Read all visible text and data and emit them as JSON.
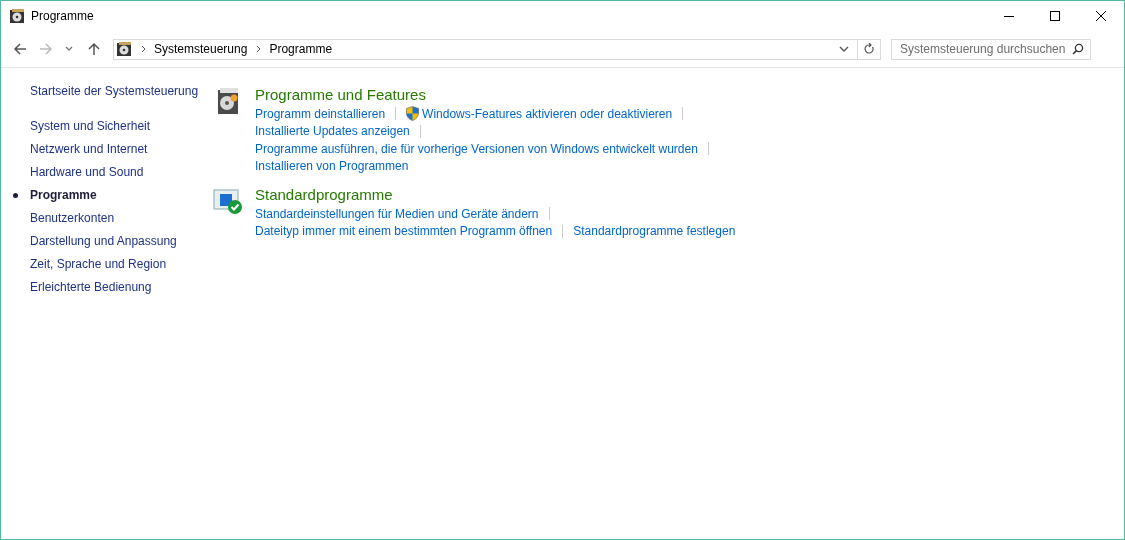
{
  "window": {
    "title": "Programme"
  },
  "address_bar": {
    "breadcrumbs": [
      "Systemsteuerung",
      "Programme"
    ]
  },
  "search": {
    "placeholder": "Systemsteuerung durchsuchen"
  },
  "sidebar": {
    "home": "Startseite der Systemsteuerung",
    "items": [
      {
        "label": "System und Sicherheit",
        "selected": false
      },
      {
        "label": "Netzwerk und Internet",
        "selected": false
      },
      {
        "label": "Hardware und Sound",
        "selected": false
      },
      {
        "label": "Programme",
        "selected": true
      },
      {
        "label": "Benutzerkonten",
        "selected": false
      },
      {
        "label": "Darstellung und Anpassung",
        "selected": false
      },
      {
        "label": "Zeit, Sprache und Region",
        "selected": false
      },
      {
        "label": "Erleichterte Bedienung",
        "selected": false
      }
    ]
  },
  "sections": [
    {
      "kind": "programs",
      "title": "Programme und Features",
      "lines": [
        [
          {
            "label": "Programm deinstallieren",
            "kind": "plain"
          },
          {
            "label": "Windows-Features aktivieren oder deaktivieren",
            "kind": "shield"
          }
        ],
        [
          {
            "label": "Installierte Updates anzeigen",
            "kind": "plain"
          }
        ],
        [
          {
            "label": "Programme ausführen, die für vorherige Versionen von Windows entwickelt wurden",
            "kind": "plain"
          }
        ],
        [
          {
            "label": "Installieren von Programmen",
            "kind": "plain"
          }
        ]
      ]
    },
    {
      "kind": "defaults",
      "title": "Standardprogramme",
      "lines": [
        [
          {
            "label": "Standardeinstellungen für Medien und Geräte ändern",
            "kind": "plain"
          }
        ],
        [
          {
            "label": "Dateityp immer mit einem bestimmten Programm öffnen",
            "kind": "plain"
          },
          {
            "label": "Standardprogramme festlegen",
            "kind": "plain"
          }
        ]
      ]
    }
  ]
}
